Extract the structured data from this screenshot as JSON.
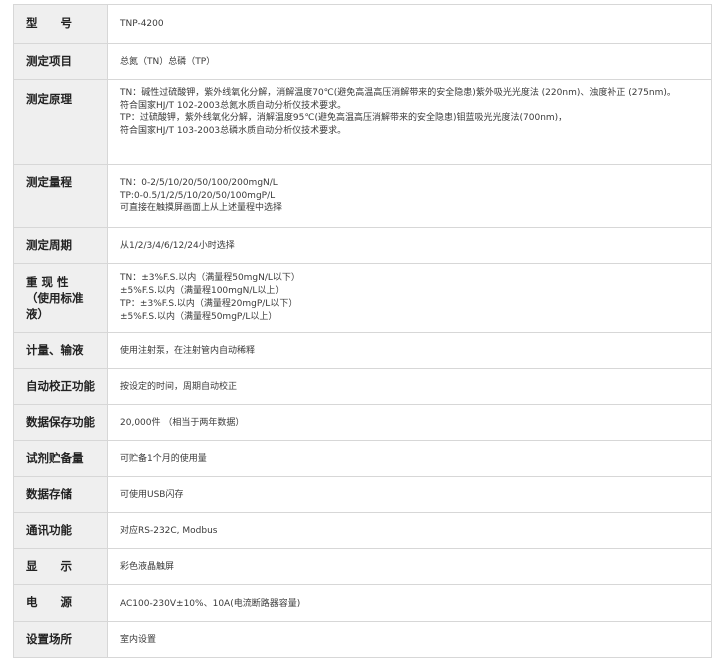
{
  "spec_table": {
    "rows": [
      {
        "label": "型　　号",
        "lines": [
          "TNP-4200"
        ]
      },
      {
        "label": "测定项目",
        "lines": [
          "总氮（TN）总磷（TP）"
        ]
      },
      {
        "label": "测定原理",
        "lines": [
          "TN：碱性过硫酸钾，紫外线氧化分解，消解温度70℃(避免高温高压消解带来的安全隐患)紫外吸光光度法 (220nm)、浊度补正 (275nm)。",
          "符合国家HJ/T 102-2003总氮水质自动分析仪技术要求。",
          "TP：过硫酸钾，紫外线氧化分解，消解温度95℃(避免高温高压消解带来的安全隐患)钼蓝吸光光度法(700nm)，",
          "符合国家HJ/T 103-2003总磷水质自动分析仪技术要求。"
        ]
      },
      {
        "label": "测定量程",
        "lines": [
          "TN：0-2/5/10/20/50/100/200mgN/L",
          "TP:0-0.5/1/2/5/10/20/50/100mgP/L",
          "可直接在触摸屏画面上从上述量程中选择"
        ]
      },
      {
        "label": "测定周期",
        "lines": [
          "从1/2/3/4/6/12/24小时选择"
        ]
      },
      {
        "label": "重 现 性\n（使用标准液）",
        "lines": [
          "TN：±3%F.S.以内（满量程50mgN/L以下）",
          "±5%F.S.以内（满量程100mgN/L以上）",
          "TP：±3%F.S.以内（满量程20mgP/L以下）",
          "±5%F.S.以内（满量程50mgP/L以上）"
        ]
      },
      {
        "label": "计量、输液",
        "lines": [
          "使用注射泵，在注射管内自动稀释"
        ]
      },
      {
        "label": "自动校正功能",
        "lines": [
          "按设定的时间，周期自动校正"
        ]
      },
      {
        "label": "数据保存功能",
        "lines": [
          "20,000件 （相当于两年数据）"
        ]
      },
      {
        "label": "试剂贮备量",
        "lines": [
          "可贮备1个月的使用量"
        ]
      },
      {
        "label": "数据存储",
        "lines": [
          "可使用USB闪存"
        ]
      },
      {
        "label": "通讯功能",
        "lines": [
          "对应RS-232C, Modbus"
        ]
      },
      {
        "label": "显　　示",
        "lines": [
          "彩色液晶触屏"
        ]
      },
      {
        "label": "电　　源",
        "lines": [
          "AC100-230V±10%、10A(电流断路器容量)"
        ]
      },
      {
        "label": "设置场所",
        "lines": [
          "室内设置"
        ]
      }
    ]
  }
}
